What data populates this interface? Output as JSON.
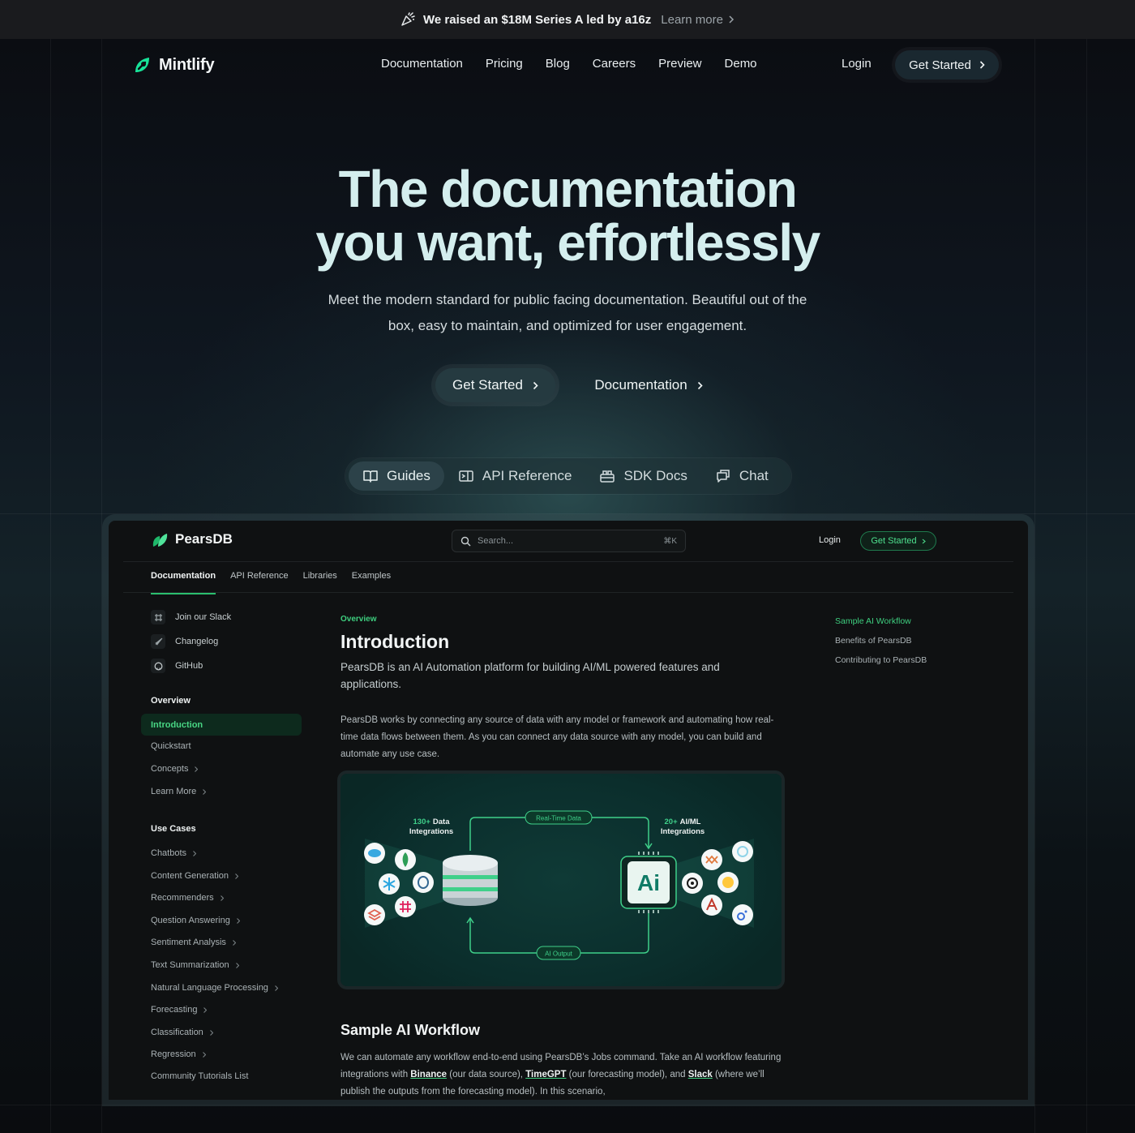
{
  "announcement": {
    "icon": "party-popper-icon",
    "text": "We raised an $18M Series A led by a16z",
    "link_label": "Learn more"
  },
  "nav": {
    "brand": "Mintlify",
    "links": [
      "Documentation",
      "Pricing",
      "Blog",
      "Careers",
      "Preview",
      "Demo"
    ],
    "login": "Login",
    "cta": "Get Started"
  },
  "hero": {
    "title_line1": "The documentation",
    "title_line2": "you want, effortlessly",
    "subtitle": "Meet the modern standard for public facing documentation. Beautiful out of the box, easy to maintain, and optimized for user engagement.",
    "primary_cta": "Get Started",
    "secondary_cta": "Documentation"
  },
  "product_tabs": [
    {
      "label": "Guides",
      "icon": "book-icon",
      "active": true
    },
    {
      "label": "API Reference",
      "icon": "code-panel-icon",
      "active": false
    },
    {
      "label": "SDK Docs",
      "icon": "package-icon",
      "active": false
    },
    {
      "label": "Chat",
      "icon": "chat-icon",
      "active": false
    }
  ],
  "demo_app": {
    "brand": "PearsDB",
    "search_placeholder": "Search...",
    "search_shortcut": "⌘K",
    "login": "Login",
    "cta": "Get Started",
    "tabs": [
      "Documentation",
      "API Reference",
      "Libraries",
      "Examples"
    ],
    "active_tab": "Documentation",
    "sidebar": {
      "links": [
        {
          "label": "Join our Slack",
          "icon": "slack-icon"
        },
        {
          "label": "Changelog",
          "icon": "rocket-icon"
        },
        {
          "label": "GitHub",
          "icon": "github-icon"
        }
      ],
      "overview_heading": "Overview",
      "overview_items": [
        {
          "label": "Introduction",
          "active": true,
          "chevron": false
        },
        {
          "label": "Quickstart",
          "active": false,
          "chevron": false
        },
        {
          "label": "Concepts",
          "active": false,
          "chevron": true
        },
        {
          "label": "Learn More",
          "active": false,
          "chevron": true
        }
      ],
      "usecases_heading": "Use Cases",
      "usecases_items": [
        {
          "label": "Chatbots",
          "chevron": true
        },
        {
          "label": "Content Generation",
          "chevron": true
        },
        {
          "label": "Recommenders",
          "chevron": true
        },
        {
          "label": "Question Answering",
          "chevron": true
        },
        {
          "label": "Sentiment Analysis",
          "chevron": true
        },
        {
          "label": "Text Summarization",
          "chevron": true
        },
        {
          "label": "Natural Language Processing",
          "chevron": true
        },
        {
          "label": "Forecasting",
          "chevron": true
        },
        {
          "label": "Classification",
          "chevron": true
        },
        {
          "label": "Regression",
          "chevron": true
        },
        {
          "label": "Community Tutorials List",
          "chevron": false
        }
      ]
    },
    "content": {
      "eyebrow": "Overview",
      "title": "Introduction",
      "lede": "PearsDB is an AI Automation platform for building AI/ML powered features and applications.",
      "paragraph": "PearsDB works by connecting any source of data with any model or framework and automating how real-time data flows between them. As you can connect any data source with any model, you can build and automate any use case.",
      "diagram": {
        "left_count": "130+",
        "left_label_1": "Data",
        "left_label_2": "Integrations",
        "right_count": "20+",
        "right_label_1": "AI/ML",
        "right_label_2": "Integrations",
        "top_pill": "Real-Time Data",
        "bottom_pill": "AI Output",
        "chip_text": "Ai"
      },
      "h2": "Sample AI Workflow",
      "p2_a": "We can automate any workflow end-to-end using PearsDB’s Jobs command. Take an AI workflow featuring integrations with ",
      "p2_link1": "Binance",
      "p2_b": " (our data source), ",
      "p2_link2": "TimeGPT",
      "p2_c": " (our forecasting model), and ",
      "p2_link3": "Slack",
      "p2_d": " (where we’ll publish the outputs from the forecasting model). In this scenario,"
    },
    "toc": [
      {
        "label": "Sample AI Workflow",
        "active": true
      },
      {
        "label": "Benefits of PearsDB",
        "active": false
      },
      {
        "label": "Contributing to PearsDB",
        "active": false
      }
    ]
  },
  "colors": {
    "accent_green": "#3ecf7f",
    "hero_title": "#d4eeee",
    "background": "#08090c"
  }
}
